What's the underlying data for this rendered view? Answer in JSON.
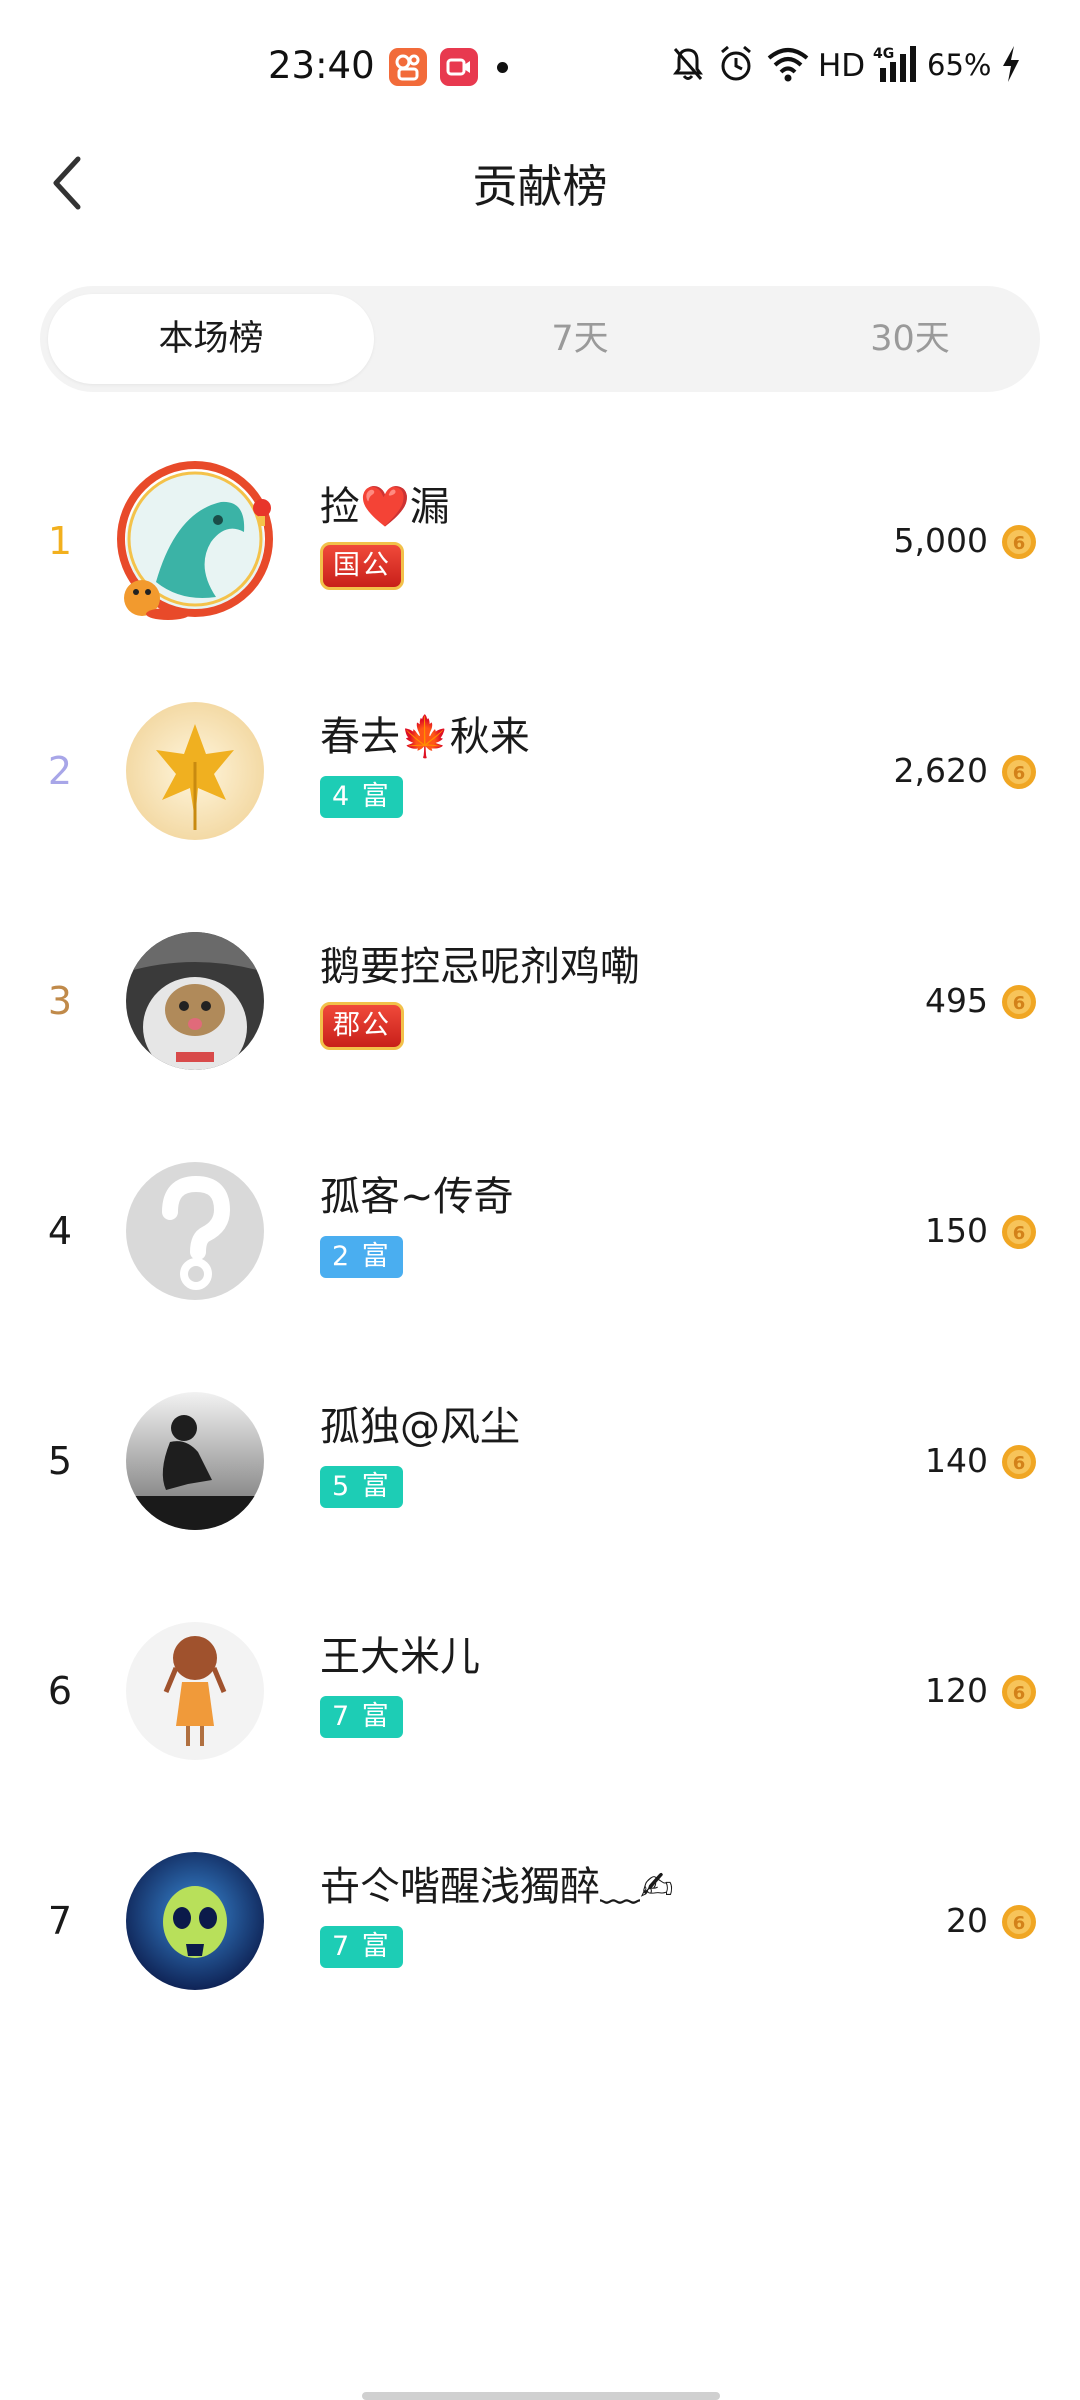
{
  "status_bar": {
    "time": "23:40",
    "network": "HD",
    "signal_label": "4G",
    "battery": "65%",
    "icons": [
      "app-notification-icon",
      "screen-record-icon",
      "dot-icon",
      "mute-bell-icon",
      "alarm-icon",
      "wifi-icon",
      "signal-icon",
      "charging-icon"
    ]
  },
  "header": {
    "title": "贡献榜",
    "back_icon": "chevron-left-icon"
  },
  "tabs": [
    {
      "label": "本场榜",
      "active": true
    },
    {
      "label": "7天",
      "active": false
    },
    {
      "label": "30天",
      "active": false
    }
  ],
  "ranking": [
    {
      "rank": "1",
      "name": "捡❤️漏",
      "badge": "国公",
      "badge_type": "noble",
      "score": "5,000"
    },
    {
      "rank": "2",
      "name": "春去🍁秋来",
      "badge": "4 富",
      "badge_type": "teal",
      "score": "2,620"
    },
    {
      "rank": "3",
      "name": "鹅要控忌呢剂鸡嘞",
      "badge": "郡公",
      "badge_type": "noble",
      "score": "495"
    },
    {
      "rank": "4",
      "name": "孤客~传奇",
      "badge": "2 富",
      "badge_type": "blue",
      "score": "150"
    },
    {
      "rank": "5",
      "name": "孤独@风尘",
      "badge": "5 富",
      "badge_type": "teal",
      "score": "140"
    },
    {
      "rank": "6",
      "name": "王大米儿",
      "badge": "7 富",
      "badge_type": "teal",
      "score": "120"
    },
    {
      "rank": "7",
      "name": "卋仒喈醒浅獨醉﹏✍",
      "badge": "7 富",
      "badge_type": "teal",
      "score": "20"
    }
  ],
  "colors": {
    "rank_1": "#f2b01e",
    "rank_2": "#a8a6e8",
    "rank_3": "#c08a4a",
    "badge_teal": "#1dcdb5",
    "badge_blue": "#4aaef0",
    "coin": "#f0a623"
  }
}
